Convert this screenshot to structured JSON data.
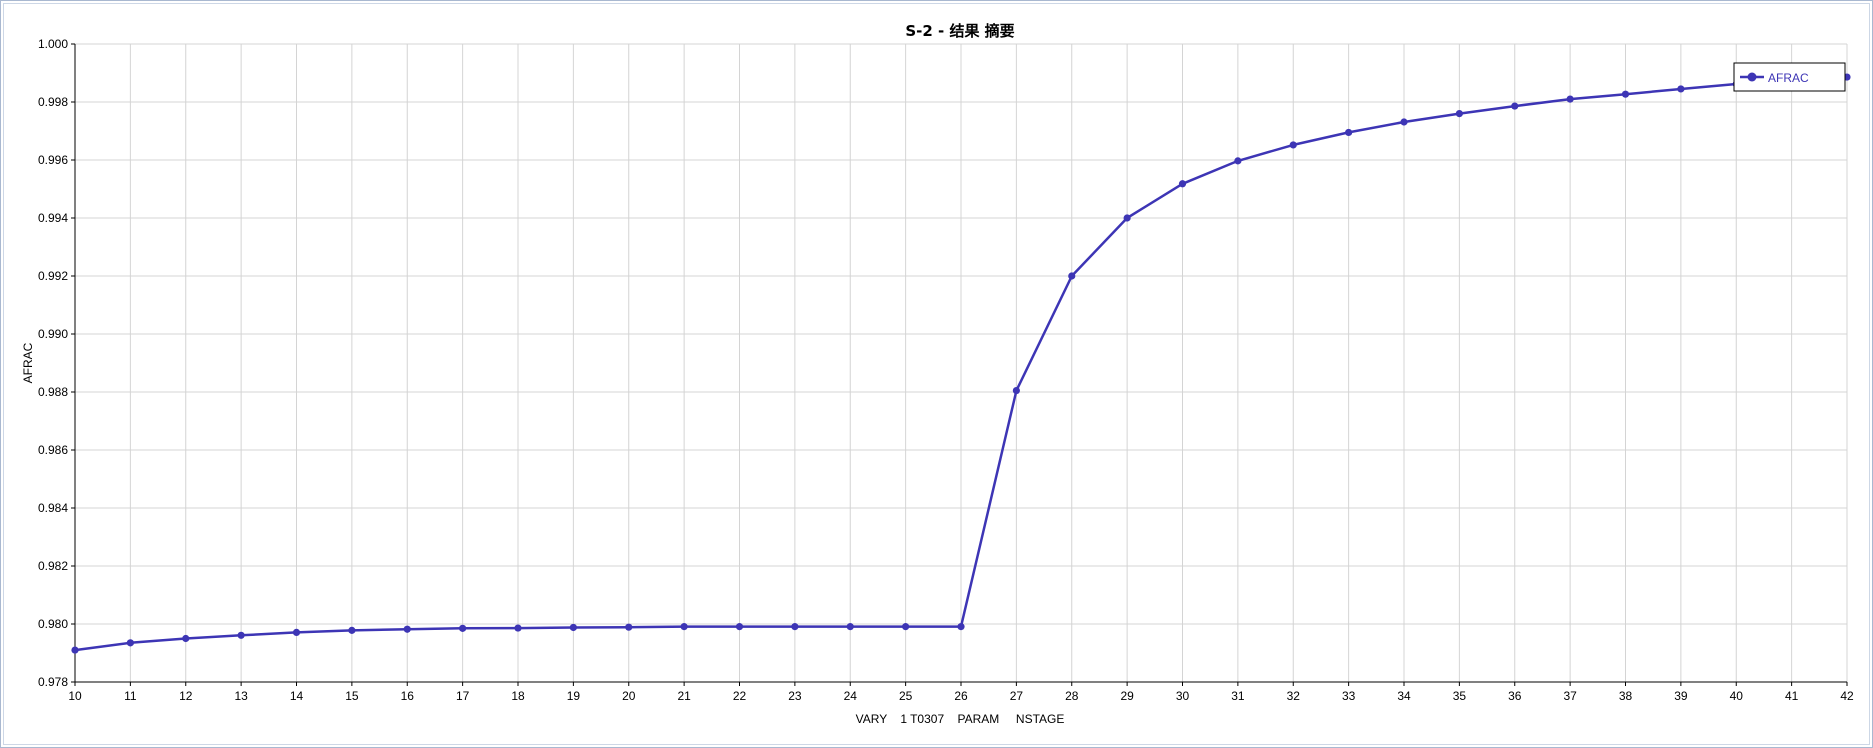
{
  "chart_data": {
    "type": "line",
    "title": "S-2 - 结果 摘要",
    "xlabel": "VARY    1 T0307    PARAM     NSTAGE",
    "ylabel": "AFRAC",
    "xlim": [
      10,
      42
    ],
    "ylim": [
      0.978,
      1.0
    ],
    "x_ticks": [
      "10",
      "11",
      "12",
      "13",
      "14",
      "15",
      "16",
      "17",
      "18",
      "19",
      "20",
      "21",
      "22",
      "23",
      "24",
      "25",
      "26",
      "27",
      "28",
      "29",
      "30",
      "31",
      "32",
      "33",
      "34",
      "35",
      "36",
      "37",
      "38",
      "39",
      "40",
      "41",
      "42"
    ],
    "y_ticks": [
      "0.978",
      "0.980",
      "0.982",
      "0.984",
      "0.986",
      "0.988",
      "0.990",
      "0.992",
      "0.994",
      "0.996",
      "0.998",
      "1.000"
    ],
    "grid": true,
    "legend_position": "top-right",
    "series": [
      {
        "name": "AFRAC",
        "color": "#3d35b5",
        "marker": "circle",
        "x": [
          10,
          11,
          12,
          13,
          14,
          15,
          16,
          17,
          18,
          19,
          20,
          21,
          22,
          23,
          24,
          25,
          26,
          27,
          28,
          29,
          30,
          31,
          32,
          33,
          34,
          35,
          36,
          37,
          38,
          39,
          40,
          41,
          42
        ],
        "y": [
          0.9791,
          0.97935,
          0.9795,
          0.97961,
          0.97971,
          0.97978,
          0.97982,
          0.97985,
          0.97986,
          0.97988,
          0.97989,
          0.97991,
          0.97991,
          0.97991,
          0.97991,
          0.97991,
          0.97991,
          0.98805,
          0.992,
          0.994,
          0.99518,
          0.99597,
          0.99652,
          0.99695,
          0.99731,
          0.9976,
          0.99786,
          0.9981,
          0.99827,
          0.99845,
          0.99862,
          0.99875,
          0.99886
        ]
      }
    ]
  }
}
